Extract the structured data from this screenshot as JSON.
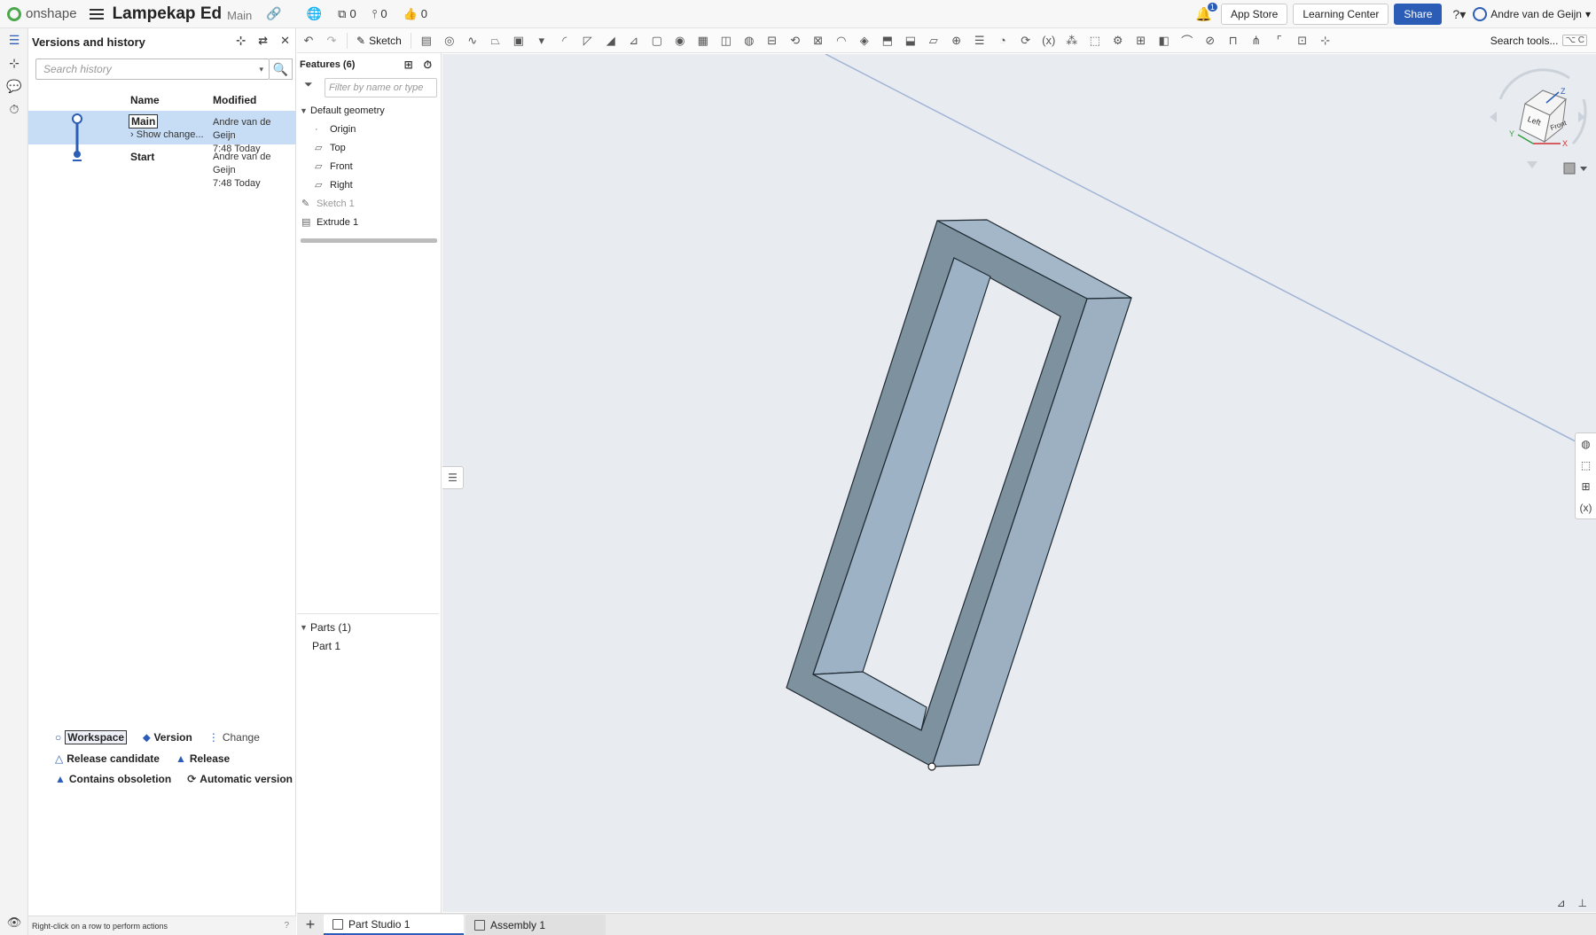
{
  "app": {
    "logo_text": "onshape",
    "doc_title": "Lampekap Ed",
    "branch": "Main",
    "counters": [
      "0",
      "0",
      "0"
    ],
    "notifications": "1",
    "app_store": "App Store",
    "learning_center": "Learning Center",
    "share": "Share",
    "user": "Andre van de Geijn"
  },
  "versions_panel": {
    "title": "Versions and history",
    "search_placeholder": "Search history",
    "col_name": "Name",
    "col_modified": "Modified",
    "rows": [
      {
        "name": "Main",
        "sub": "Show change...",
        "author": "Andre van de Geijn",
        "time": "7:48 Today"
      },
      {
        "name": "Start",
        "sub": "",
        "author": "Andre van de Geijn",
        "time": "7:48 Today"
      }
    ],
    "legend": {
      "workspace": "Workspace",
      "version": "Version",
      "change": "Change",
      "release_candidate": "Release candidate",
      "release": "Release",
      "contains_obsoletion": "Contains obsoletion",
      "automatic_version": "Automatic version"
    },
    "status": "Right-click on a row to perform actions"
  },
  "features": {
    "title": "Features (6)",
    "filter_placeholder": "Filter by name or type",
    "default_geometry": "Default geometry",
    "items": [
      "Origin",
      "Top",
      "Front",
      "Right"
    ],
    "sketch": "Sketch 1",
    "extrude": "Extrude 1",
    "parts_header": "Parts (1)",
    "part": "Part 1"
  },
  "toolbar": {
    "sketch_label": "Sketch",
    "search_label": "Search tools...",
    "search_shortcut": "⌥ C"
  },
  "viewcube": {
    "left": "Left",
    "front": "Front",
    "axis_x": "X",
    "axis_y": "Y",
    "axis_z": "Z"
  },
  "tabs": [
    "Part Studio 1",
    "Assembly 1"
  ],
  "colors": {
    "accent": "#2b5db6",
    "selection": "#c6ddf5",
    "viewport_bg": "#e8ebef",
    "part_light": "#9db2c5",
    "part_dark": "#7b8e9c"
  }
}
